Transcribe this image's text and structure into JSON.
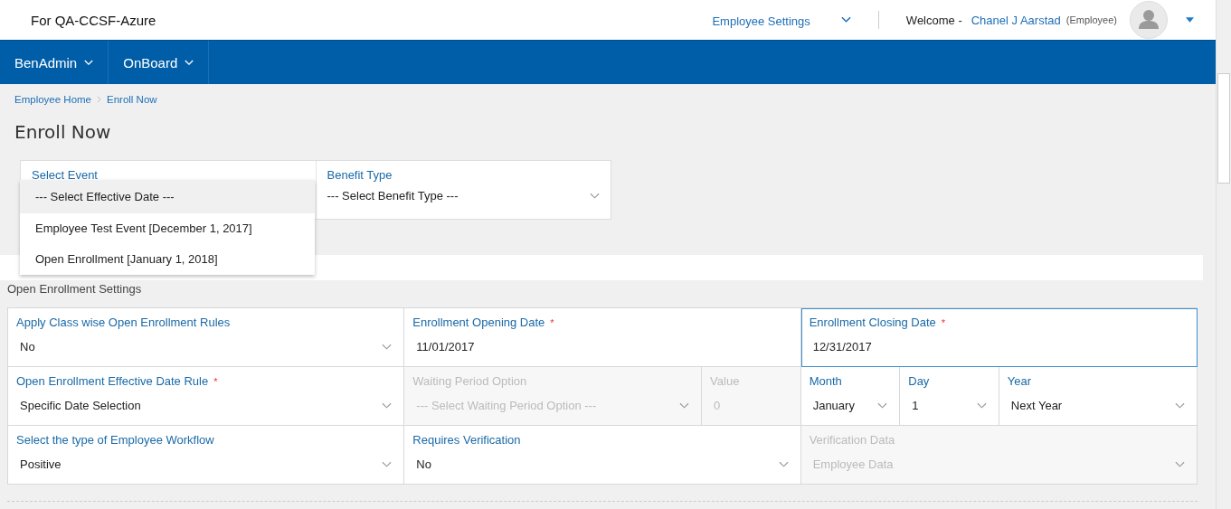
{
  "header": {
    "tenant": "For QA-CCSF-Azure",
    "settings_menu": "Employee Settings",
    "welcome": "Welcome -",
    "user_name": "Chanel J Aarstad",
    "user_role": "(Employee)"
  },
  "nav": [
    {
      "label": "BenAdmin"
    },
    {
      "label": "OnBoard"
    }
  ],
  "breadcrumb": [
    {
      "label": "Employee Home"
    },
    {
      "label": "Enroll Now"
    }
  ],
  "page_title": "Enroll Now",
  "event_filters": [
    {
      "label": "Select Event",
      "kind": "open"
    },
    {
      "label": "Benefit Type",
      "value": "--- Select Benefit Type ---",
      "kind": "select"
    }
  ],
  "event_options": [
    {
      "label": "--- Select Effective Date ---",
      "selected": true
    },
    {
      "label": "Employee Test Event [December 1, 2017]",
      "selected": false
    },
    {
      "label": "Open Enrollment [January 1, 2018]",
      "selected": false
    }
  ],
  "settings": {
    "title": "Open Enrollment Settings",
    "rows": [
      [
        {
          "label": "Apply Class wise Open Enrollment Rules",
          "value": "No",
          "kind": "select",
          "disabled": false,
          "focused": false
        },
        {
          "label": "Enrollment Opening Date",
          "required_mark": "*",
          "value": "11/01/2017",
          "kind": "text",
          "disabled": false,
          "focused": false
        },
        {
          "label": "Enrollment Closing Date",
          "required_mark": "*",
          "value": "12/31/2017",
          "kind": "text",
          "disabled": false,
          "focused": true
        }
      ],
      [
        {
          "label": "Open Enrollment Effective Date Rule",
          "required_mark": "*",
          "value": "Specific Date Selection",
          "kind": "select",
          "disabled": false,
          "focused": false
        },
        {
          "label": "Waiting Period Option",
          "value": "--- Select Waiting Period Option ---",
          "kind": "select",
          "disabled": true,
          "focused": false
        },
        {
          "label": "Value",
          "value": "0",
          "kind": "text",
          "disabled": true,
          "focused": false
        },
        {
          "label": "Month",
          "value": "January",
          "kind": "select",
          "disabled": false,
          "focused": false
        },
        {
          "label": "Day",
          "value": "1",
          "kind": "select",
          "disabled": false,
          "focused": false
        },
        {
          "label": "Year",
          "value": "Next Year",
          "kind": "select",
          "disabled": false,
          "focused": false
        }
      ],
      [
        {
          "label": "Select the type of Employee Workflow",
          "value": "Positive",
          "kind": "select",
          "disabled": false,
          "focused": false
        },
        {
          "label": "Requires Verification",
          "value": "No",
          "kind": "select",
          "disabled": false,
          "focused": false
        },
        {
          "label": "Verification Data",
          "value": "Employee Data",
          "kind": "select",
          "disabled": true,
          "focused": false
        }
      ]
    ]
  }
}
